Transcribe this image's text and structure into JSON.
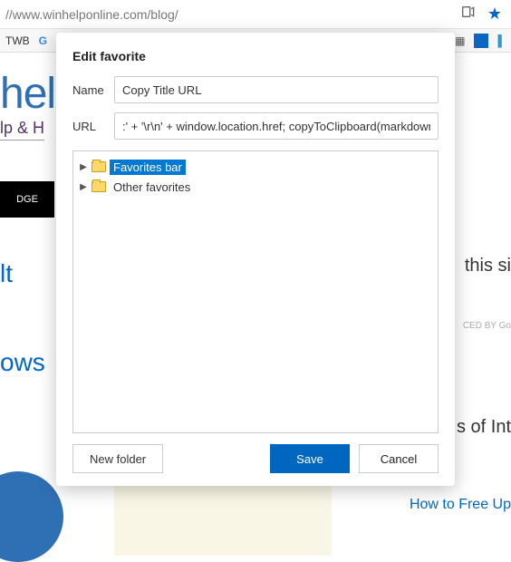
{
  "chrome": {
    "url_display": "//www.winhelponline.com/blog/",
    "read_aloud_tooltip": "Read aloud",
    "favorite_tooltip": "Favorite"
  },
  "subbar": {
    "twb": "TWB",
    "g": "G"
  },
  "background": {
    "logo_big": "help",
    "logo_small": "lp & H",
    "black_bar": "DGE",
    "side_search": "this si",
    "side_enhanced": "CED BY Go",
    "side_sof": "s of Int",
    "side_freeup": "How to Free Up",
    "lt": "lt",
    "ows": "ows"
  },
  "dialog": {
    "title": "Edit favorite",
    "name_label": "Name",
    "name_value": "Copy Title URL",
    "url_label": "URL",
    "url_value": ":' + '\\r\\n' + window.location.href; copyToClipboard(markdown); })();",
    "tree": {
      "items": [
        {
          "label": "Favorites bar",
          "selected": true
        },
        {
          "label": "Other favorites",
          "selected": false
        }
      ]
    },
    "buttons": {
      "new_folder": "New folder",
      "save": "Save",
      "cancel": "Cancel"
    }
  }
}
